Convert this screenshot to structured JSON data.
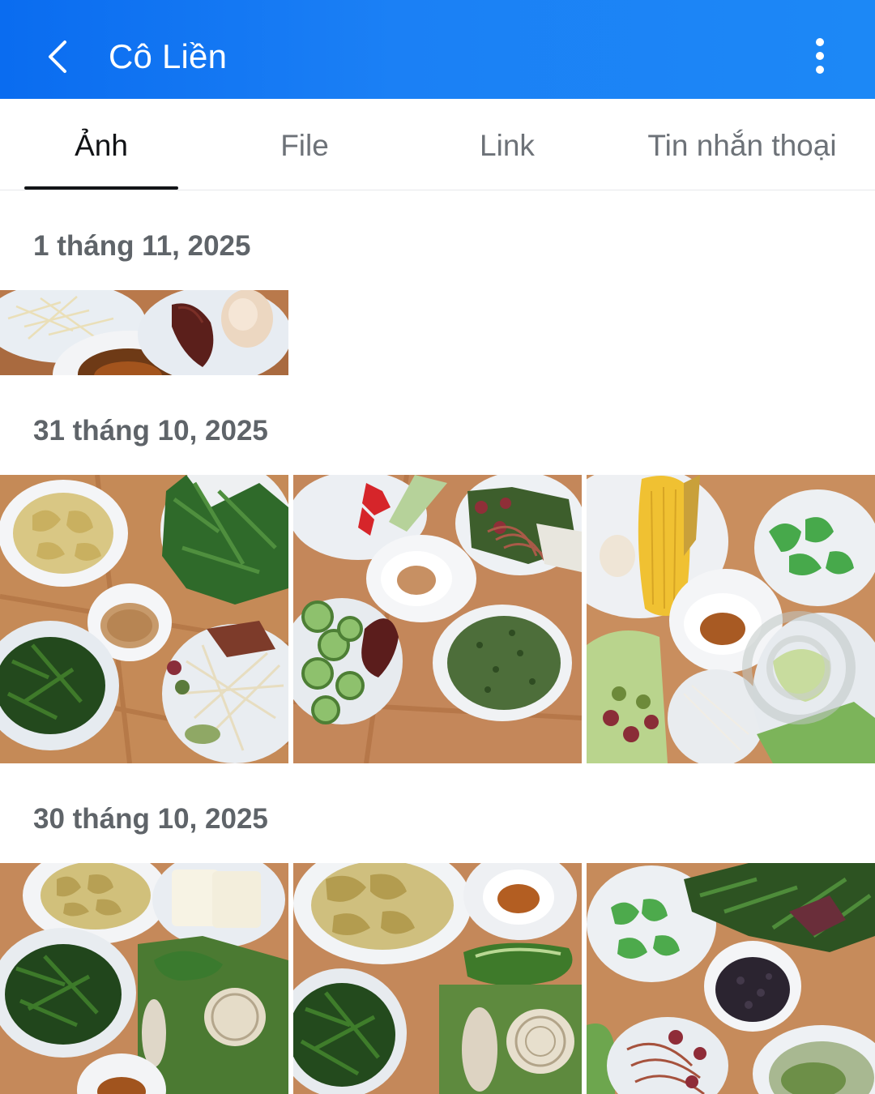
{
  "header": {
    "title": "Cô Liền",
    "back_icon": "chevron-left-icon",
    "more_icon": "more-vertical-icon"
  },
  "tabs": [
    {
      "label": "Ảnh",
      "active": true
    },
    {
      "label": "File",
      "active": false
    },
    {
      "label": "Link",
      "active": false
    },
    {
      "label": "Tin nhắn thoại",
      "active": false
    }
  ],
  "sections": [
    {
      "date": "1 tháng 11, 2025",
      "photo_count": 1
    },
    {
      "date": "31 tháng 10, 2025",
      "photo_count": 3
    },
    {
      "date": "30 tháng 10, 2025",
      "photo_count": 3
    }
  ],
  "colors": {
    "header_blue": "#1b80f5",
    "tab_active": "#101215",
    "tab_inactive": "#6d7278",
    "date_text": "#5f6469"
  }
}
